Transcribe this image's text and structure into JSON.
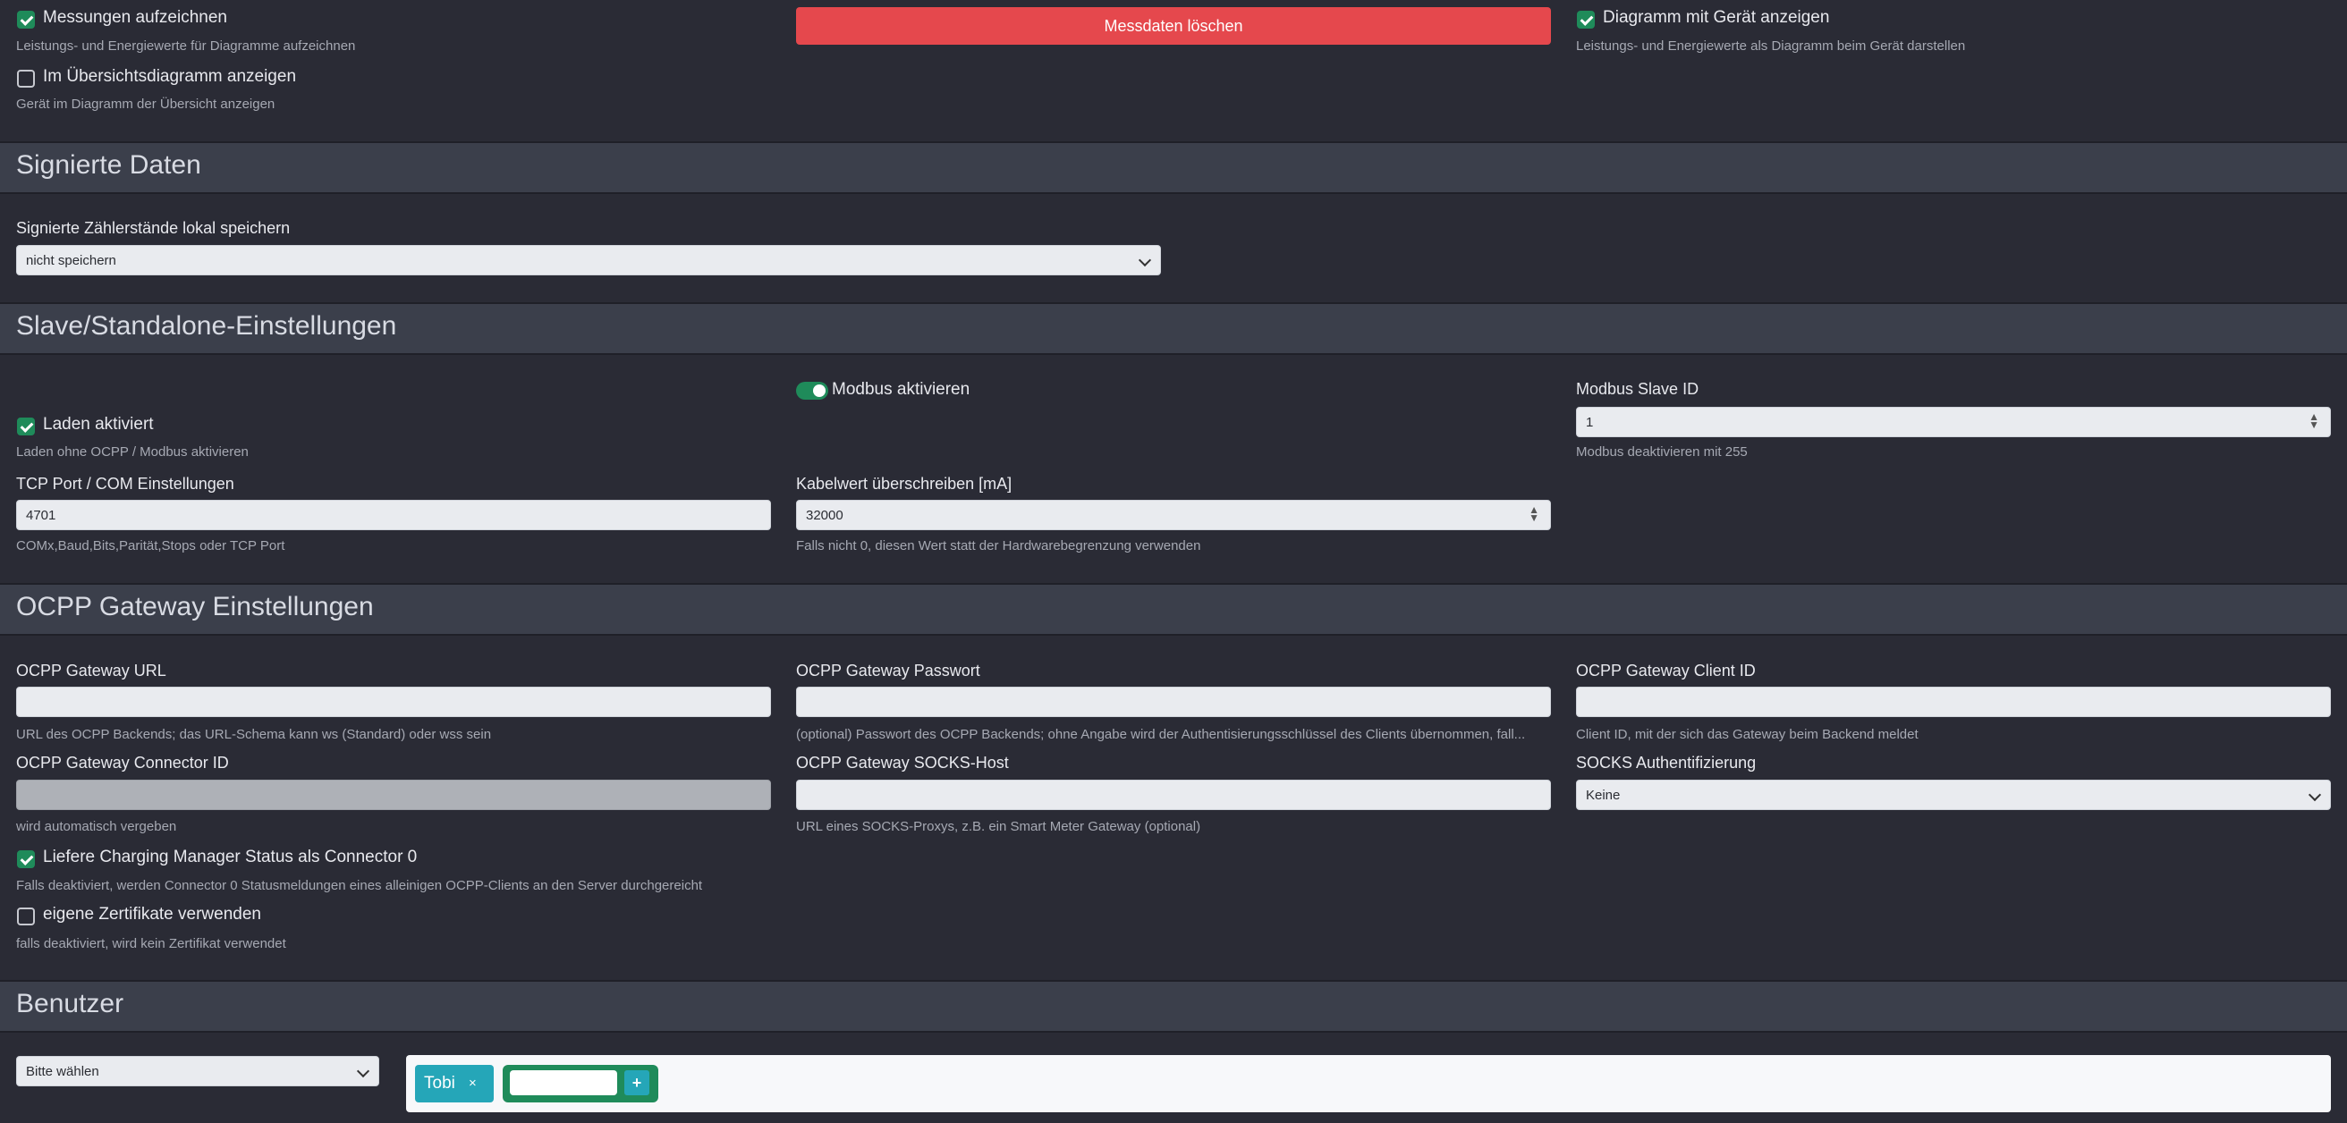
{
  "measurements": {
    "record_label": "Messungen aufzeichnen",
    "record_hint": "Leistungs- und Energiewerte für Diagramme aufzeichnen",
    "record_checked": true,
    "overview_label": "Im Übersichtsdiagramm anzeigen",
    "overview_hint": "Gerät im Diagramm der Übersicht anzeigen",
    "overview_checked": false,
    "delete_button": "Messdaten löschen",
    "device_chart_label": "Diagramm mit Gerät anzeigen",
    "device_chart_hint": "Leistungs- und Energiewerte als Diagramm beim Gerät darstellen",
    "device_chart_checked": true
  },
  "signed": {
    "title": "Signierte Daten",
    "store_label": "Signierte Zählerstände lokal speichern",
    "store_value": "nicht speichern"
  },
  "slave": {
    "title": "Slave/Standalone-Einstellungen",
    "modbus_toggle_label": "Modbus aktivieren",
    "modbus_enabled": true,
    "slave_id_label": "Modbus Slave ID",
    "slave_id_value": "1",
    "slave_id_hint": "Modbus deaktivieren mit 255",
    "charging_label": "Laden aktiviert",
    "charging_hint": "Laden ohne OCPP / Modbus aktivieren",
    "charging_checked": true,
    "tcp_label": "TCP Port / COM Einstellungen",
    "tcp_value": "4701",
    "tcp_hint": "COMx,Baud,Bits,Parität,Stops oder TCP Port",
    "cable_label": "Kabelwert überschreiben [mA]",
    "cable_value": "32000",
    "cable_hint": "Falls nicht 0, diesen Wert statt der Hardwarebegrenzung verwenden"
  },
  "ocpp": {
    "title": "OCPP Gateway Einstellungen",
    "url_label": "OCPP Gateway URL",
    "url_value": "",
    "url_hint": "URL des OCPP Backends; das URL-Schema kann ws (Standard) oder wss sein",
    "password_label": "OCPP Gateway Passwort",
    "password_value": "",
    "password_hint": "(optional) Passwort des OCPP Backends; ohne Angabe wird der Authentisierungsschlüssel des Clients übernommen, fall...",
    "client_id_label": "OCPP Gateway Client ID",
    "client_id_value": "",
    "client_id_hint": "Client ID, mit der sich das Gateway beim Backend meldet",
    "connector_label": "OCPP Gateway Connector ID",
    "connector_value": "",
    "connector_hint": "wird automatisch vergeben",
    "socks_host_label": "OCPP Gateway SOCKS-Host",
    "socks_host_value": "",
    "socks_host_hint": "URL eines SOCKS-Proxys, z.B. ein Smart Meter Gateway (optional)",
    "socks_auth_label": "SOCKS Authentifizierung",
    "socks_auth_value": "Keine",
    "cm_label": "Liefere Charging Manager Status als Connector 0",
    "cm_hint": "Falls deaktiviert, werden Connector 0 Statusmeldungen eines alleinigen OCPP-Clients an den Server durchgereicht",
    "cm_checked": true,
    "cert_label": "eigene Zertifikate verwenden",
    "cert_hint": "falls deaktiviert, wird kein Zertifikat verwendet",
    "cert_checked": false
  },
  "users": {
    "title": "Benutzer",
    "select_value": "Bitte wählen",
    "tags": [
      {
        "name": "Tobi",
        "remove": "×"
      }
    ],
    "add_symbol": "+"
  },
  "colors": {
    "background": "#2a2b35",
    "header": "#3b3f4b",
    "danger": "#e5484d",
    "success": "#1f8b5a",
    "info": "#25a6b8"
  }
}
